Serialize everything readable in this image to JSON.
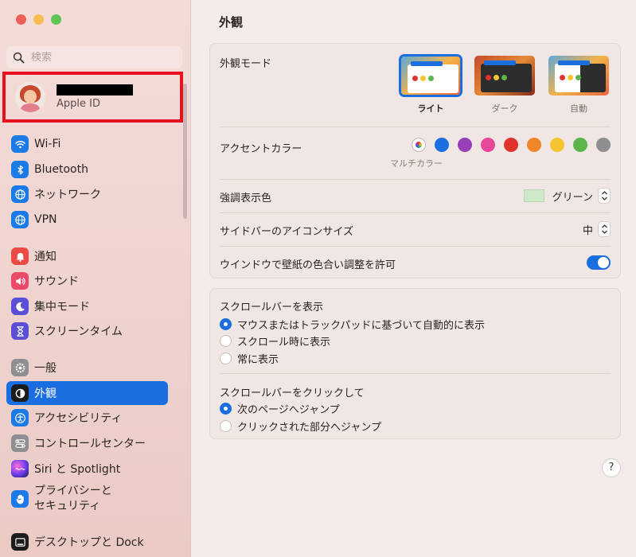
{
  "sidebar": {
    "search_placeholder": "検索",
    "apple_id_label": "Apple ID",
    "items": [
      {
        "label": "Wi-Fi"
      },
      {
        "label": "Bluetooth"
      },
      {
        "label": "ネットワーク"
      },
      {
        "label": "VPN"
      },
      {
        "label": "通知"
      },
      {
        "label": "サウンド"
      },
      {
        "label": "集中モード"
      },
      {
        "label": "スクリーンタイム"
      },
      {
        "label": "一般"
      },
      {
        "label": "外観"
      },
      {
        "label": "アクセシビリティ"
      },
      {
        "label": "コントロールセンター"
      },
      {
        "label": "Siri と Spotlight"
      },
      {
        "label": "プライバシーと\nセキュリティ"
      },
      {
        "label": "デスクトップと Dock"
      }
    ]
  },
  "main": {
    "title": "外観",
    "appearance_mode": {
      "label": "外観モード",
      "options": [
        {
          "label": "ライト",
          "selected": true
        },
        {
          "label": "ダーク",
          "selected": false
        },
        {
          "label": "自動",
          "selected": false
        }
      ]
    },
    "accent_color": {
      "label": "アクセントカラー",
      "selected_caption": "マルチカラー",
      "colors": [
        "multicolor",
        "#1a6ee0",
        "#9a3fb5",
        "#e8479a",
        "#e0332e",
        "#f0862a",
        "#f5c431",
        "#5bb54b",
        "#8e8e8e"
      ]
    },
    "highlight_color": {
      "label": "強調表示色",
      "value": "グリーン",
      "swatch": "#cde9c9"
    },
    "sidebar_icon_size": {
      "label": "サイドバーのアイコンサイズ",
      "value": "中"
    },
    "wallpaper_tinting": {
      "label": "ウインドウで壁紙の色合い調整を許可",
      "on": true
    },
    "show_scrollbars": {
      "label": "スクロールバーを表示",
      "options": [
        {
          "label": "マウスまたはトラックパッドに基づいて自動的に表示",
          "selected": true
        },
        {
          "label": "スクロール時に表示",
          "selected": false
        },
        {
          "label": "常に表示",
          "selected": false
        }
      ]
    },
    "click_scrollbar": {
      "label": "スクロールバーをクリックして",
      "options": [
        {
          "label": "次のページへジャンプ",
          "selected": true
        },
        {
          "label": "クリックされた部分へジャンプ",
          "selected": false
        }
      ]
    },
    "help_label": "?"
  },
  "colors": {
    "accent": "#1a6ee0",
    "highlight_box": "#e8101e"
  }
}
